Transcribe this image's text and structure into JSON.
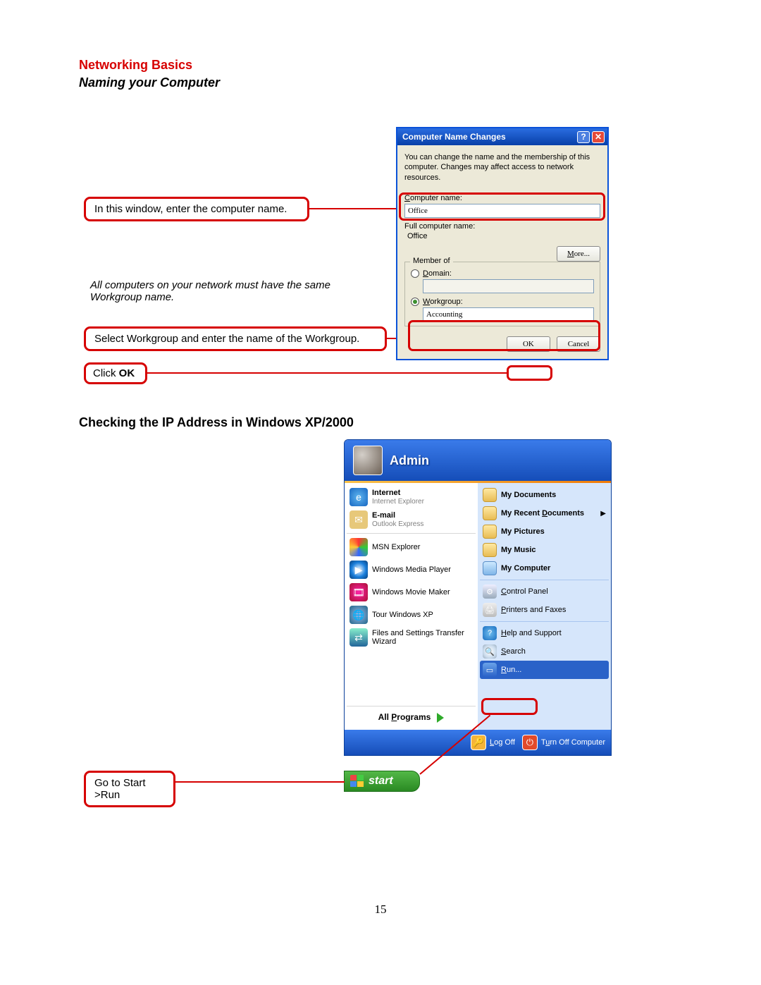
{
  "headings": {
    "section": "Networking Basics",
    "subtitle": "Naming your Computer",
    "section2": "Checking the IP Address in Windows XP/2000"
  },
  "callouts": {
    "c1": "In this window, enter the computer name.",
    "note": "All computers on your network must have the same Workgroup name.",
    "c2": "Select Workgroup and enter the name of the Workgroup.",
    "c3_pre": "Click ",
    "c3_b": "OK",
    "c4": "Go to Start >Run"
  },
  "dialog": {
    "title": "Computer Name Changes",
    "desc": "You can change the name and the membership of this computer. Changes may affect access to network resources.",
    "computer_name_label": "Computer name:",
    "computer_name_value": "Office",
    "full_name_label": "Full computer name:",
    "full_name_value": "Office",
    "more": "More...",
    "group_legend": "Member of",
    "domain_label": "Domain:",
    "workgroup_label": "Workgroup:",
    "workgroup_value": "Accounting",
    "ok": "OK",
    "cancel": "Cancel"
  },
  "startmenu": {
    "user": "Admin",
    "left": {
      "internet_t": "Internet",
      "internet_s": "Internet Explorer",
      "email_t": "E-mail",
      "email_s": "Outlook Express",
      "msn": "MSN Explorer",
      "wmp": "Windows Media Player",
      "wmm": "Windows Movie Maker",
      "tour": "Tour Windows XP",
      "fst": "Files and Settings Transfer Wizard",
      "all_programs": "All Programs"
    },
    "right": {
      "mydocs": "My Documents",
      "recent": "My Recent Documents",
      "mypics": "My Pictures",
      "mymusic": "My Music",
      "mycomp": "My Computer",
      "cpanel": "Control Panel",
      "printers": "Printers and Faxes",
      "help": "Help and Support",
      "search": "Search",
      "run": "Run..."
    },
    "footer": {
      "logoff": "Log Off",
      "turnoff": "Turn Off Computer"
    },
    "start_button": "start"
  },
  "page_number": "15"
}
